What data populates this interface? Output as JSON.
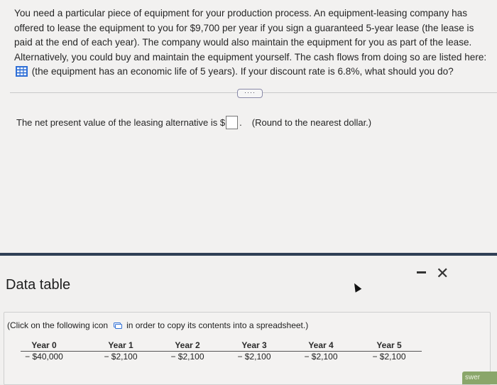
{
  "question": {
    "text_before_icon": "You need a particular piece of equipment for your production process. An equipment-leasing company has offered to lease the equipment to you for $9,700 per year if you sign a guaranteed 5-year lease (the lease is paid at the end of each year). The company would also maintain the equipment for you as part of the lease. Alternatively, you could buy and maintain the equipment yourself. The cash flows from doing so are listed here:",
    "text_after_icon": "(the equipment has an economic life of 5 years). If your discount rate is 6.8%, what should you do?",
    "grid_icon": "table-grid-icon",
    "more_button_label": "····"
  },
  "answer": {
    "prompt": "The net present value of the leasing alternative is $",
    "after_box": ".",
    "hint": "(Round to the nearest dollar.)"
  },
  "modal": {
    "title": "Data table",
    "minimize_label": "−",
    "close_label": "✕",
    "copy_text_before": "(Click on the following icon",
    "copy_text_after": "in order to copy its contents into a spreadsheet.)",
    "table": {
      "headers": [
        "Year 0",
        "Year 1",
        "Year 2",
        "Year 3",
        "Year 4",
        "Year 5"
      ],
      "values": [
        "− $40,000",
        "− $2,100",
        "− $2,100",
        "− $2,100",
        "− $2,100",
        "− $2,100"
      ]
    }
  },
  "corner_button": {
    "label": "swer"
  },
  "colors": {
    "accent_blue": "#2f6fd6",
    "modal_border": "#2f3f55",
    "corner_green": "#8aa66a"
  }
}
